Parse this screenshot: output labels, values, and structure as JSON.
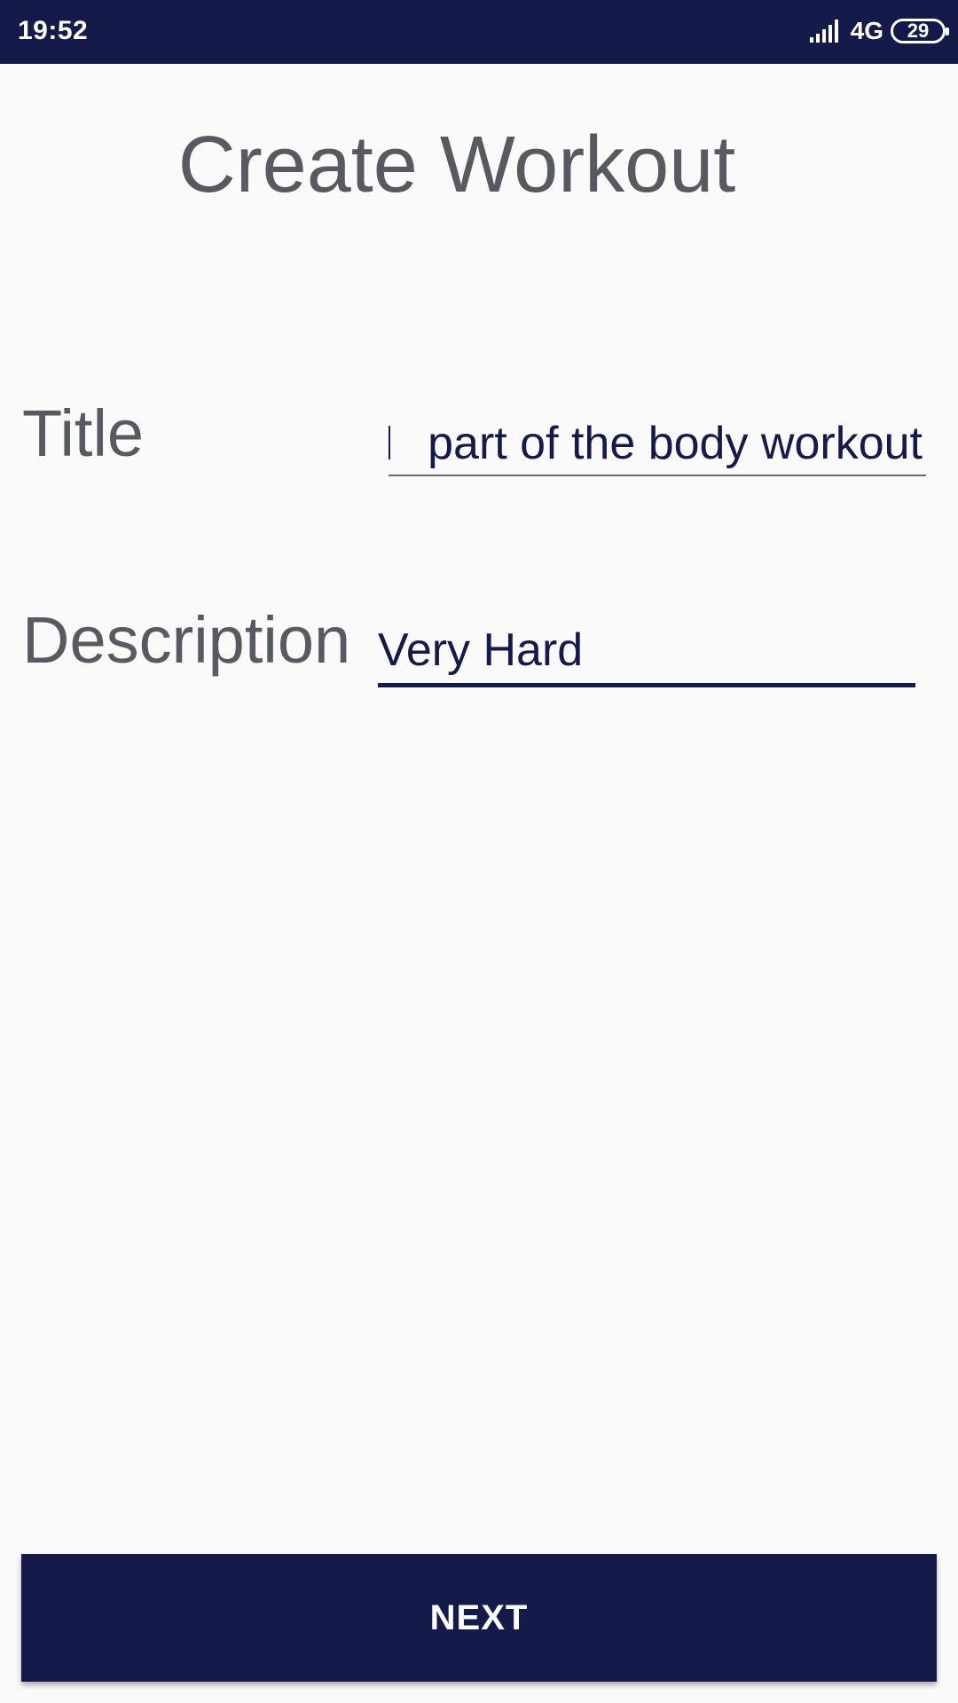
{
  "status_bar": {
    "time": "19:52",
    "network": "4G",
    "battery": "29",
    "signal_icon": "signal-bars-icon",
    "battery_icon": "battery-icon"
  },
  "header": {
    "title": "Create Workout"
  },
  "form": {
    "title_label": "Title",
    "title_value": "part of the body workout",
    "description_label": "Description",
    "description_value": "Very Hard"
  },
  "footer": {
    "next_label": "NEXT"
  },
  "colors": {
    "primary": "#141a4a",
    "background": "#fafafa",
    "label_text": "#575a60"
  }
}
